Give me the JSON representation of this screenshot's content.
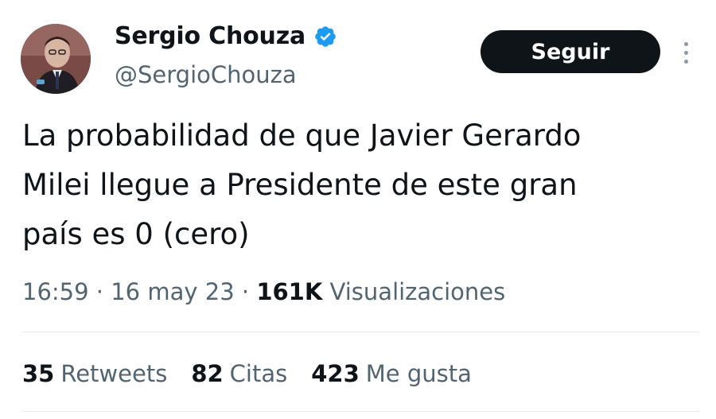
{
  "author": {
    "display_name": "Sergio Chouza",
    "handle": "@SergioChouza",
    "verified": true,
    "verified_color": "#1d9bf0"
  },
  "follow_button": {
    "label": "Seguir"
  },
  "tweet": {
    "text": "La probabilidad de que Javier Gerardo\nMilei llegue a Presidente de este gran\npaís es 0 (cero)"
  },
  "meta": {
    "time": "16:59",
    "separator": "·",
    "date": "16 may 23",
    "views_count": "161K",
    "views_label": "Visualizaciones"
  },
  "stats": {
    "retweets_count": "35",
    "retweets_label": "Retweets",
    "quotes_count": "82",
    "quotes_label": "Citas",
    "likes_count": "423",
    "likes_label": "Me gusta"
  },
  "icons": {
    "verified": "verified-badge-icon",
    "more": "more-options-icon"
  },
  "colors": {
    "text_primary": "#0f1419",
    "text_secondary": "#536471",
    "button_bg": "#0f1419",
    "button_text": "#ffffff"
  }
}
